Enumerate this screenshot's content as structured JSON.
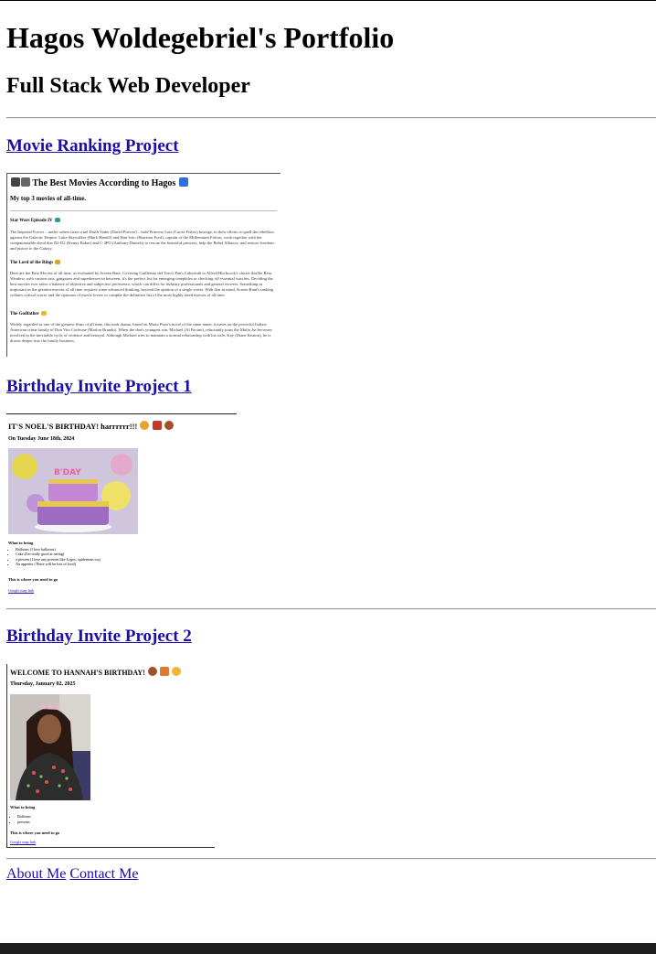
{
  "header": {
    "title": "Hagos Woldegebriel's Portfolio",
    "subtitle": "Full Stack Web Developer"
  },
  "projects": [
    {
      "link": "Movie Ranking Project",
      "preview": {
        "heading": "The Best Movies According to Hagos",
        "subheading": "My top 3 movies of all-time.",
        "movies": [
          {
            "title": "Star Wars Episode IV",
            "text": "The Imperial Forces – under orders from cruel Darth Vader (David Prowse) – hold Princess Leia (Carrie Fisher) hostage, in their efforts to quell the rebellion against the Galactic Empire. Luke Skywalker (Mark Hamill) and Han Solo (Harrison Ford), captain of the Millennium Falcon, work together with the companionable droid duo R2-D2 (Kenny Baker) and C-3PO (Anthony Daniels) to rescue the beautiful princess, help the Rebel Alliance, and restore freedom and justice to the Galaxy."
          },
          {
            "title": "The Lord of the Rings",
            "text": "Here are the Best Movies of all time, as evaluated by Screen Rant. Covering Guillermo del Toro's Pan's Labyrinth to Alfred Hitchcock's classic thriller Rear Window, with cartoon rats, gangsters and superheroes in between, it's the perfect list for emerging cinephiles or checking off essential watches. Deciding the best movies ever takes a balance of objective and subjective preference, which can differ for industry professionals and general viewers. Something as important as the greatest movies of all time requires some advanced thinking, beyond the opinion of a single writer. With that in mind, Screen Rant's ranking collates critical scores and the opinions of movie lovers to compile the definitive list of the most highly rated movies of all time."
          },
          {
            "title": "The Godfather",
            "text": "Widely regarded as one of the greatest films of all time, this mob drama, based on Mario Puzo's novel of the same name, focuses on the powerful Italian-American crime family of Don Vito Corleone (Marlon Brando). When the don's youngest son, Michael (Al Pacino), reluctantly joins the Mafia, he becomes involved in the inevitable cycle of violence and betrayal. Although Michael tries to maintain a normal relationship with his wife, Kay (Diane Keaton), he is drawn deeper into the family business."
          }
        ]
      }
    },
    {
      "link": "Birthday Invite Project 1",
      "preview": {
        "heading": "IT'S NOEL'S BIRTHDAY! harrrrrr!!!",
        "date": "On Tuesday June 18th, 2024",
        "bring_label": "What to bring",
        "items": [
          "Balloons (I love balloons)",
          "Cake (I'm really good at eating)",
          "a present (I love any present like Legos, spiderman toy)",
          "An appetite (There will be lots of food)"
        ],
        "where_label": "This is where you need to go",
        "map_link": "Google map link"
      }
    },
    {
      "link": "Birthday Invite Project 2",
      "preview": {
        "heading": "WELCOME TO HANNAH'S BIRTHDAY!",
        "date": "Thursday, January 02, 2025",
        "bring_label": "What to bring",
        "items": [
          "Balloons",
          "presents"
        ],
        "where_label": "This is where you need to go",
        "map_link": "Google map link"
      }
    }
  ],
  "footer": {
    "about": "About Me",
    "contact": "Contact Me"
  },
  "icons": [
    "clapper-icon",
    "film-icon",
    "tv-icon",
    "sword-icon",
    "ring-icon",
    "face-icon",
    "cake-icon",
    "car-icon",
    "burger-icon",
    "gift-icon",
    "smile-icon"
  ]
}
